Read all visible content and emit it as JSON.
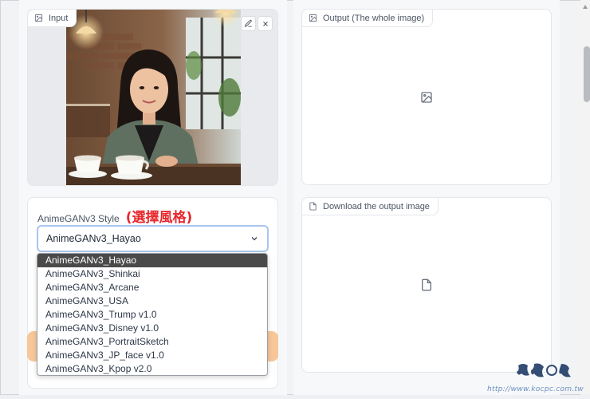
{
  "input": {
    "label": "Input",
    "edit_label": "edit",
    "clear_label": "clear"
  },
  "style": {
    "label": "AnimeGANv3 Style",
    "annotation": "(選擇風格)",
    "selected": "AnimeGANv3_Hayao",
    "options": [
      "AnimeGANv3_Hayao",
      "AnimeGANv3_Shinkai",
      "AnimeGANv3_Arcane",
      "AnimeGANv3_USA",
      "AnimeGANv3_Trump v1.0",
      "AnimeGANv3_Disney v1.0",
      "AnimeGANv3_PortraitSketch",
      "AnimeGANv3_JP_face v1.0",
      "AnimeGANv3_Kpop v2.0"
    ],
    "highlighted_index": 0
  },
  "output": {
    "label": "Output (The whole image)"
  },
  "download": {
    "label": "Download the output image"
  },
  "watermark": {
    "url": "http://www.kocpc.com.tw"
  },
  "colors": {
    "accent": "#f7c79a",
    "focus_border": "#a9c6ef",
    "annotation": "#e8282d",
    "highlight": "#4a4a4a"
  },
  "icons": {
    "image_icon": "image-icon",
    "file_icon": "file-icon",
    "pencil_icon": "pencil-icon",
    "close_icon": "close-icon",
    "chevron_icon": "chevron-down-icon"
  }
}
